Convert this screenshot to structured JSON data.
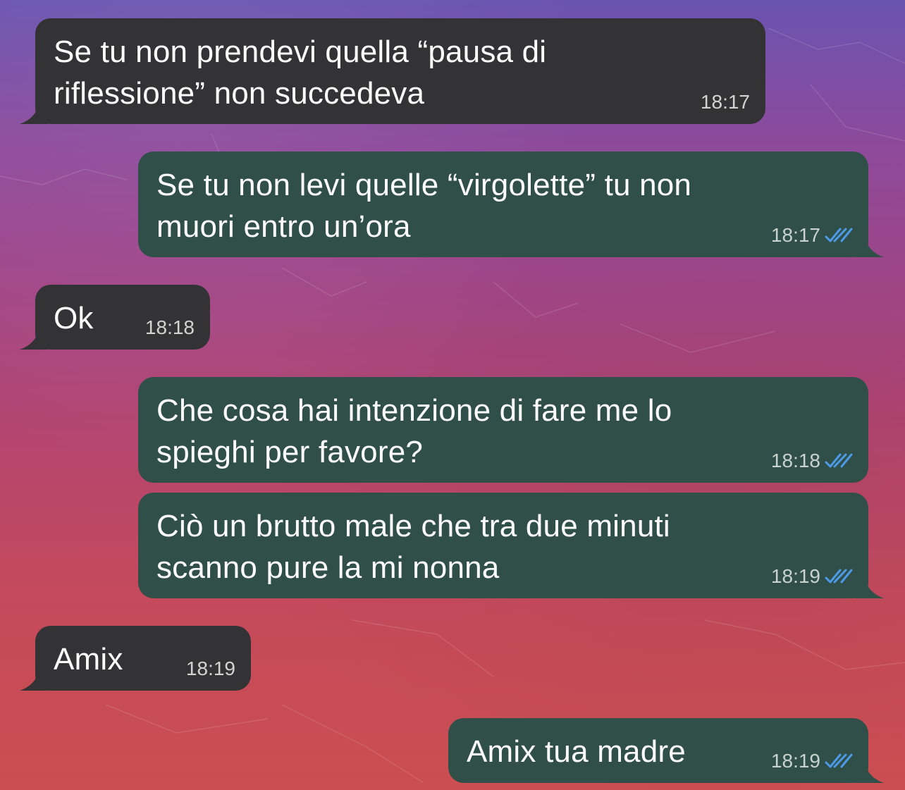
{
  "colors": {
    "incoming_bubble": "#333336",
    "outgoing_bubble": "#2f4f48",
    "read_ticks": "#4d9be8",
    "timestamp": "#d2d4d0"
  },
  "messages": [
    {
      "direction": "in",
      "text": "Se tu non prendevi quella “pausa di\nriflessione” non succedeva",
      "time": "18:17"
    },
    {
      "direction": "out",
      "text": "Se tu non levi quelle “virgolette” tu non\nmuori entro un’ora",
      "time": "18:17",
      "status_icon": "double-check-read"
    },
    {
      "direction": "in",
      "text": "Ok",
      "time": "18:18"
    },
    {
      "direction": "out",
      "text": "Che cosa hai intenzione di fare me lo\nspieghi per favore?",
      "time": "18:18",
      "status_icon": "double-check-read"
    },
    {
      "direction": "out",
      "text": "Ciò un brutto male che tra due minuti\nscanno pure la mi nonna",
      "time": "18:19",
      "status_icon": "double-check-read"
    },
    {
      "direction": "in",
      "text": "Amix",
      "time": "18:19"
    },
    {
      "direction": "out",
      "text": "Amix tua madre",
      "time": "18:19",
      "status_icon": "double-check-read"
    }
  ]
}
